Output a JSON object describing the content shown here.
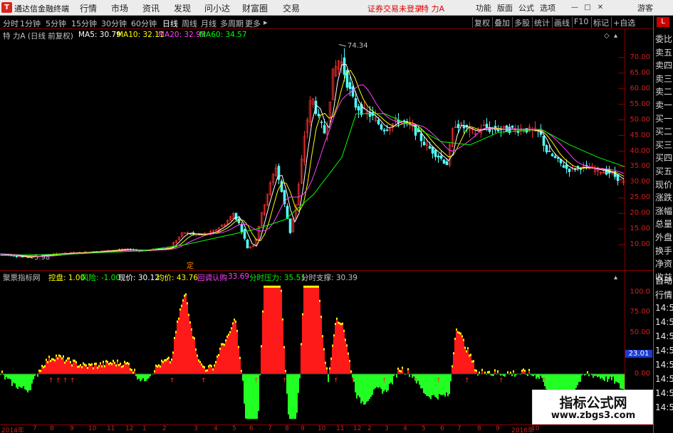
{
  "titlebar": {
    "app_name": "通达信金融终端",
    "menus": [
      "行情",
      "市场",
      "资讯",
      "发现",
      "问小达",
      "财富圈",
      "交易"
    ],
    "warning": "证券交易未登录",
    "stock_name": "特 力A",
    "right_buttons": [
      "功能",
      "版面",
      "公式",
      "选项"
    ],
    "login": "游客"
  },
  "periodbar": {
    "tabs": [
      "分时",
      "1分钟",
      "5分钟",
      "15分钟",
      "30分钟",
      "60分钟",
      "日线",
      "周线",
      "月线",
      "多周期",
      "更多"
    ],
    "active_tab": "日线",
    "tools": [
      "复权",
      "叠加",
      "多股",
      "统计",
      "画线",
      "F10",
      "标记",
      "+自选"
    ]
  },
  "main_chart": {
    "header": "特 力A (日线 前复权)",
    "ma": [
      {
        "label": "MA5: 30.79",
        "color": "#ffffff"
      },
      {
        "label": "MA10: 32.11",
        "color": "#ffff00"
      },
      {
        "label": "MA20: 32.95",
        "color": "#ff40ff"
      },
      {
        "label": "MA60: 34.57",
        "color": "#00ff00"
      }
    ],
    "yticks": [
      "70.00",
      "65.00",
      "60.00",
      "55.00",
      "50.00",
      "45.00",
      "40.00",
      "35.00",
      "30.00",
      "25.00",
      "20.00",
      "15.00",
      "10.00"
    ],
    "high_label": "74.34",
    "low_label": "5.98",
    "marker": "定"
  },
  "indicator": {
    "name": "聚票指标网",
    "items": [
      {
        "label": "控盘: 1.00",
        "color": "#ffff00"
      },
      {
        "label": "风险: -1.00",
        "color": "#00ff00"
      },
      {
        "label": "现价: 30.12",
        "color": "#ffffff"
      },
      {
        "label": "均价: 43.76",
        "color": "#ffff00"
      },
      {
        "label": "回调认购",
        "color": "#ff40ff"
      },
      {
        "label": "33.69",
        "color": "#ff40ff"
      },
      {
        "label": "分时压力: 35.51",
        "color": "#00ff00"
      },
      {
        "label": "分时支撑: 30.39",
        "color": "#c0c0c0"
      }
    ],
    "yticks": [
      "100.0",
      "75.00",
      "50.00",
      "25.00",
      "0.00"
    ],
    "current_value": "23.01"
  },
  "sidebar": {
    "items": [
      "委比",
      "卖五",
      "卖四",
      "卖三",
      "卖二",
      "卖一",
      "买一",
      "买二",
      "买三",
      "买四",
      "买五",
      "现价",
      "涨跌",
      "涨幅",
      "总量",
      "外盘",
      "换手",
      "净资",
      "收益",
      "自动",
      "行情",
      "14:5",
      "14:5",
      "14:5",
      "14:5",
      "14:5",
      "14:5",
      "14:5",
      "14:5"
    ]
  },
  "datebar": {
    "labels": [
      "2014年",
      "7",
      "8",
      "9",
      "10",
      "11",
      "12",
      "1",
      "2",
      "3",
      "4",
      "5",
      "6",
      "7",
      "8",
      "9",
      "10",
      "11",
      "12",
      "2",
      "3",
      "4",
      "5",
      "6",
      "7",
      "8",
      "9",
      "2016年",
      "10"
    ]
  },
  "watermark": {
    "line1": "指标公式网",
    "line2": "www.zbgs3.com"
  },
  "chart_data": {
    "type": "line",
    "title": "",
    "price_ylim": [
      5,
      75
    ],
    "price_path": [
      [
        0,
        7
      ],
      [
        20,
        6.5
      ],
      [
        40,
        6
      ],
      [
        60,
        6.5
      ],
      [
        80,
        7
      ],
      [
        100,
        7.3
      ],
      [
        120,
        7.5
      ],
      [
        140,
        7.8
      ],
      [
        160,
        8.2
      ],
      [
        180,
        8.5
      ],
      [
        200,
        8
      ],
      [
        220,
        8.5
      ],
      [
        240,
        9
      ],
      [
        260,
        14
      ],
      [
        280,
        13
      ],
      [
        300,
        14
      ],
      [
        320,
        17
      ],
      [
        330,
        20
      ],
      [
        340,
        16
      ],
      [
        350,
        9
      ],
      [
        360,
        10
      ],
      [
        370,
        20
      ],
      [
        380,
        28
      ],
      [
        390,
        35
      ],
      [
        400,
        25
      ],
      [
        410,
        14
      ],
      [
        420,
        25
      ],
      [
        430,
        45
      ],
      [
        440,
        58
      ],
      [
        450,
        50
      ],
      [
        460,
        45
      ],
      [
        470,
        65
      ],
      [
        480,
        70
      ],
      [
        490,
        62
      ],
      [
        500,
        55
      ],
      [
        510,
        53
      ],
      [
        520,
        52
      ],
      [
        530,
        50
      ],
      [
        540,
        47
      ],
      [
        550,
        48
      ],
      [
        560,
        50
      ],
      [
        570,
        49
      ],
      [
        580,
        48
      ],
      [
        590,
        45
      ],
      [
        600,
        42
      ],
      [
        610,
        40
      ],
      [
        620,
        38
      ],
      [
        630,
        36
      ],
      [
        640,
        49
      ],
      [
        650,
        48
      ],
      [
        660,
        47
      ],
      [
        670,
        46
      ],
      [
        680,
        48
      ],
      [
        690,
        47
      ],
      [
        700,
        47
      ],
      [
        720,
        47
      ],
      [
        740,
        47
      ],
      [
        760,
        46
      ],
      [
        770,
        40
      ],
      [
        780,
        38
      ],
      [
        800,
        34
      ],
      [
        820,
        35
      ],
      [
        840,
        34
      ],
      [
        860,
        33
      ],
      [
        877,
        30
      ]
    ],
    "ma60_path": [
      [
        0,
        6.5
      ],
      [
        100,
        7
      ],
      [
        200,
        8
      ],
      [
        260,
        10
      ],
      [
        320,
        13
      ],
      [
        360,
        15
      ],
      [
        400,
        18
      ],
      [
        440,
        26
      ],
      [
        480,
        38
      ],
      [
        500,
        52
      ],
      [
        540,
        52
      ],
      [
        580,
        48
      ],
      [
        620,
        43
      ],
      [
        660,
        42
      ],
      [
        700,
        46
      ],
      [
        760,
        47
      ],
      [
        800,
        42
      ],
      [
        840,
        38
      ],
      [
        877,
        35
      ]
    ],
    "indicator_ylim": [
      -60,
      110
    ]
  }
}
